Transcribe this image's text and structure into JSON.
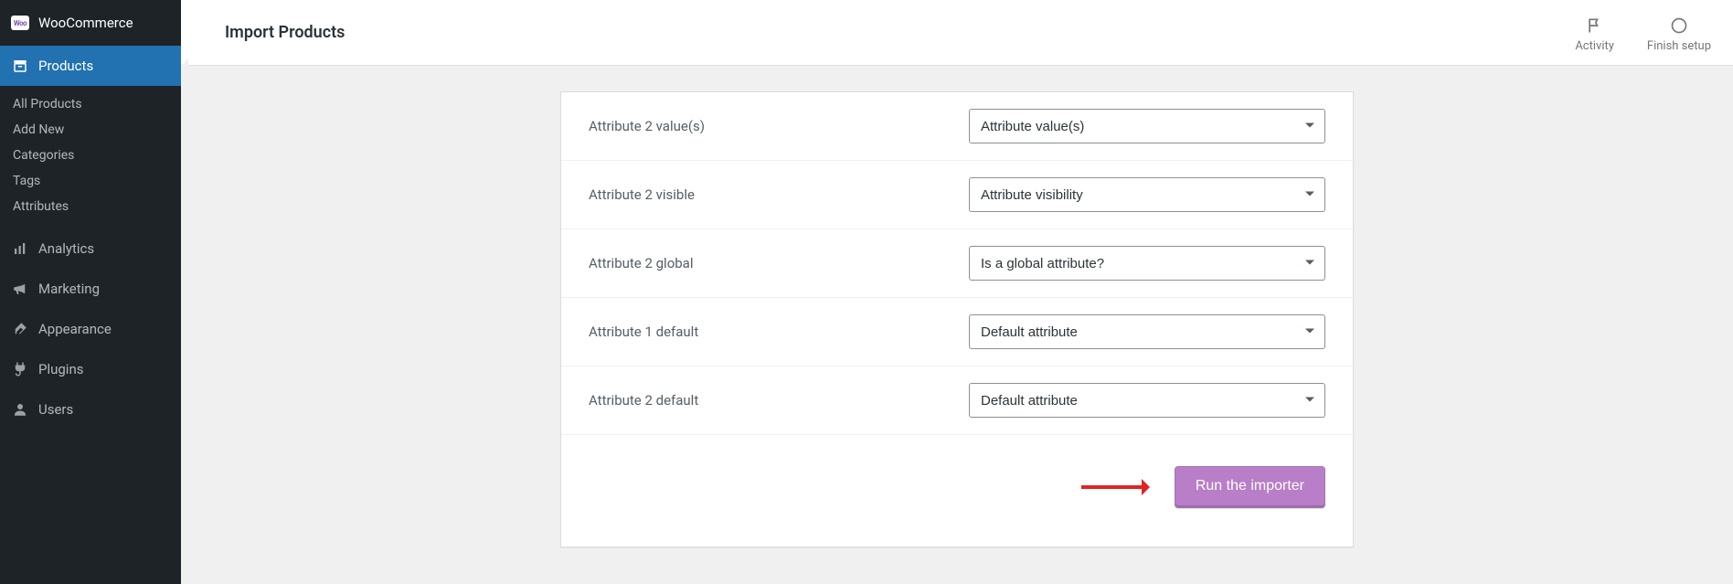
{
  "sidebar": {
    "top_label": "WooCommerce",
    "active_label": "Products",
    "submenu": [
      {
        "label": "All Products"
      },
      {
        "label": "Add New"
      },
      {
        "label": "Categories"
      },
      {
        "label": "Tags"
      },
      {
        "label": "Attributes"
      }
    ],
    "items": [
      {
        "label": "Analytics"
      },
      {
        "label": "Marketing"
      },
      {
        "label": "Appearance"
      },
      {
        "label": "Plugins"
      },
      {
        "label": "Users"
      }
    ]
  },
  "header": {
    "page_title": "Import Products",
    "actions": {
      "activity_label": "Activity",
      "finish_label": "Finish setup"
    }
  },
  "form": {
    "rows": [
      {
        "label": "Attribute 2 value(s)",
        "selected": "Attribute value(s)"
      },
      {
        "label": "Attribute 2 visible",
        "selected": "Attribute visibility"
      },
      {
        "label": "Attribute 2 global",
        "selected": "Is a global attribute?"
      },
      {
        "label": "Attribute 1 default",
        "selected": "Default attribute"
      },
      {
        "label": "Attribute 2 default",
        "selected": "Default attribute"
      }
    ],
    "run_label": "Run the importer"
  }
}
